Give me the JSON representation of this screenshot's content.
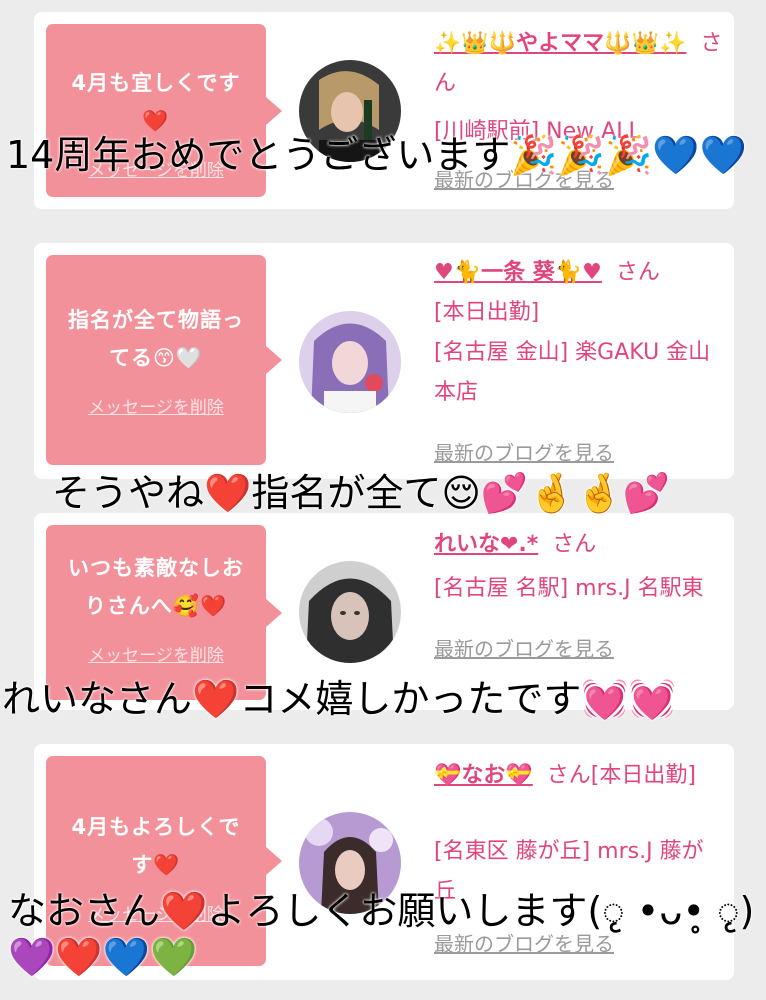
{
  "cards": [
    {
      "message": "4月も宜しくです❤️",
      "delete_label": "メッセージを削除",
      "name": "✨👑🔱やよママ🔱👑✨",
      "san": "さん",
      "shop": "[川崎駅前] New ALL",
      "blog_label": "最新のブログを見る"
    },
    {
      "message": "指名が全て物語ってる😙🤍",
      "delete_label": "メッセージを削除",
      "name": "♥🐈一条 葵🐈♥",
      "san": "さん",
      "status": "[本日出勤]",
      "shop": "[名古屋 金山] 楽GAKU 金山本店",
      "blog_label": "最新のブログを見る"
    },
    {
      "message": "いつも素敵なしおりさんへ🥰❤️",
      "delete_label": "メッセージを削除",
      "name": "れいな❤.*",
      "san": "さん",
      "shop": "[名古屋 名駅] mrs.J 名駅東",
      "blog_label": "最新のブログを見る"
    },
    {
      "message": "4月もよろしくです❤️",
      "delete_label": "メッセージを削除",
      "name": "💝なお💝",
      "san": "さん[本日出勤]",
      "shop": "[名東区 藤が丘] mrs.J 藤が丘",
      "blog_label": "最新のブログを見る"
    }
  ],
  "overlays": [
    "14周年おめでとうございます🎉🎉🎉💙💙",
    "そうやね❤️指名が全て😌💕🤞🤞💕",
    "れいなさん❤️コメ嬉しかったです💓💓",
    "なおさん❤️よろしくお願いします(ृ •ᴗ•̥ ृ)💜❤️💙💚"
  ],
  "colors": {
    "bubble": "#f3919a",
    "accent": "#e0457e",
    "link_gray": "#9a9a9a"
  }
}
